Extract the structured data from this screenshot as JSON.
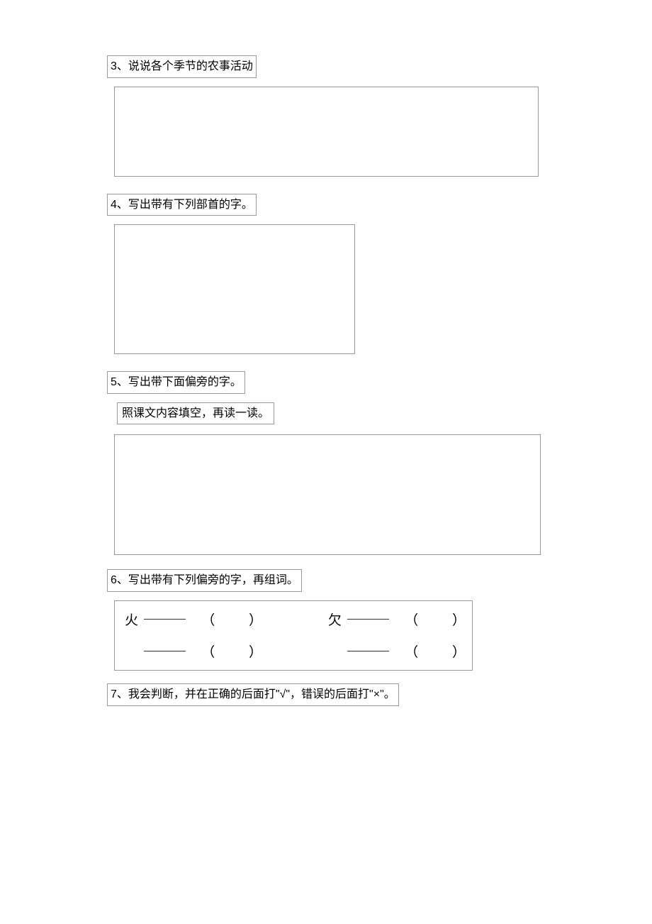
{
  "questions": {
    "q3": {
      "title": "3、说说各个季节的农事活动"
    },
    "q4": {
      "title": "4、写出带有下列部首的字。"
    },
    "q5": {
      "title": "5、写出带下面偏旁的字。",
      "sub": "照课文内容填空，再读一读。"
    },
    "q6": {
      "title": "6、写出带有下列偏旁的字，再组词。",
      "row1": {
        "char1": "火",
        "char2": "欠"
      }
    },
    "q7": {
      "title": "7、我会判断，并在正确的后面打\"√\"，错误的后面打\"×\"。"
    }
  }
}
